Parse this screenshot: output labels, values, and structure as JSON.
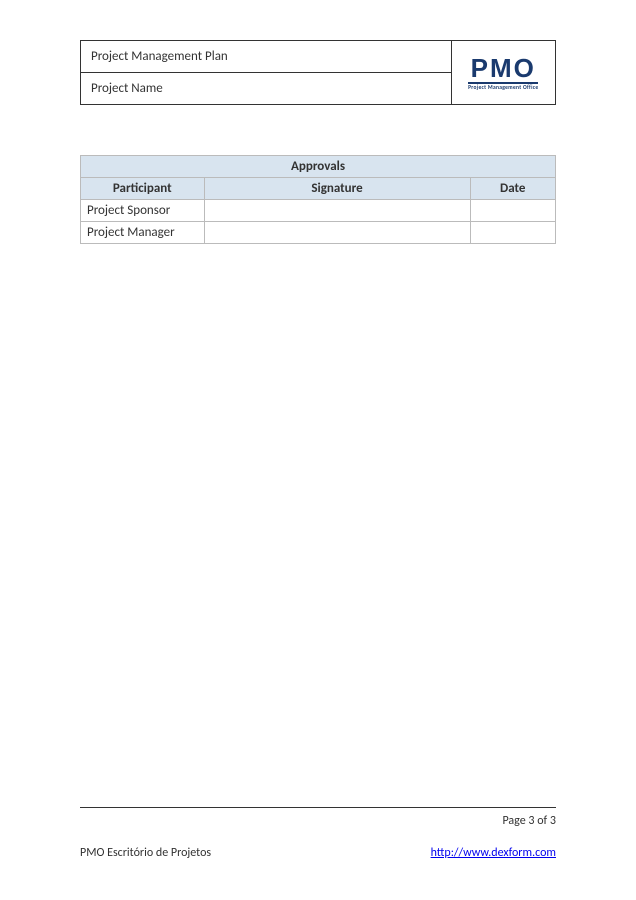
{
  "header": {
    "title": "Project Management Plan",
    "projectName": "Project Name",
    "logo": {
      "text": "PMO",
      "subtitle": "Project Management Office"
    }
  },
  "approvals": {
    "title": "Approvals",
    "columns": {
      "participant": "Participant",
      "signature": "Signature",
      "date": "Date"
    },
    "rows": [
      {
        "participant": "Project Sponsor",
        "signature": "",
        "date": ""
      },
      {
        "participant": "Project Manager",
        "signature": "",
        "date": ""
      }
    ]
  },
  "footer": {
    "pageLabel": "Page 3 of 3",
    "orgName": "PMO Escritório de Projetos",
    "link": "http://www.dexform.com"
  }
}
